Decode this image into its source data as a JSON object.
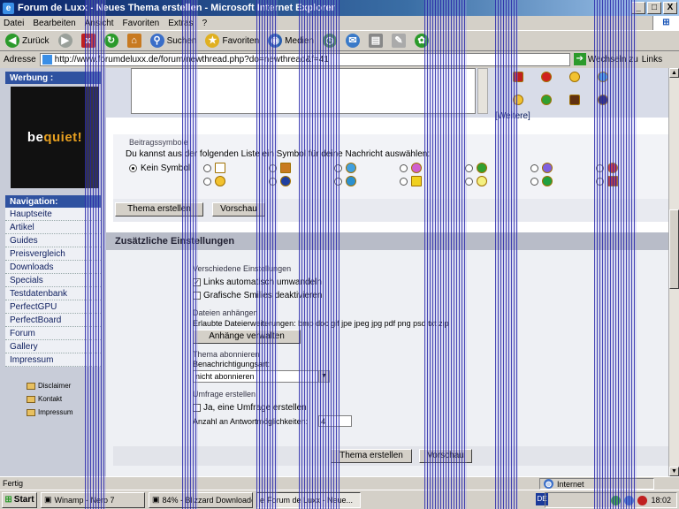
{
  "window": {
    "title": "Forum de Luxx - Neues Thema erstellen - Microsoft Internet Explorer",
    "controls": [
      "_",
      "□",
      "X"
    ]
  },
  "menu": [
    "Datei",
    "Bearbeiten",
    "Ansicht",
    "Favoriten",
    "Extras",
    "?"
  ],
  "toolbar": {
    "back": "Zurück",
    "search": "Suchen",
    "favorites": "Favoriten",
    "media": "Medien"
  },
  "address": {
    "label": "Adresse",
    "url": "http://www.forumdeluxx.de/forum/newthread.php?do=newthread&f=41",
    "go": "Wechseln zu",
    "links": "Links"
  },
  "sidebar": {
    "ad_heading": "Werbung :",
    "ad_text_1": "be ",
    "ad_text_2": "quiet!",
    "nav_heading": "Navigation:",
    "nav_items": [
      "Hauptseite",
      "Artikel",
      "Guides",
      "Preisvergleich",
      "Downloads",
      "Specials",
      "Testdatenbank",
      "PerfectGPU",
      "PerfectBoard",
      "Forum",
      "Gallery",
      "Impressum"
    ],
    "sub_items": [
      "Disclaimer",
      "Kontakt",
      "Impressum"
    ]
  },
  "editor": {
    "more_link": "[Weitere]"
  },
  "symbols": {
    "heading": "Beitragssymbole",
    "instruction": "Du kannst aus der folgenden Liste ein Symbol für deine Nachricht auswählen:",
    "none_label": "Kein Symbol"
  },
  "buttons": {
    "create_thread": "Thema erstellen",
    "preview": "Vorschau"
  },
  "extra_settings": {
    "heading": "Zusätzliche Einstellungen",
    "misc_heading": "Verschiedene Einstellungen",
    "auto_links": "Links automatisch umwandeln",
    "disable_smilies": "Grafische Smilies deaktivieren",
    "attach_heading": "Dateien anhängen",
    "allowed_ext": "Erlaubte Dateierweiterungen: bmp doc gif jpe jpeg jpg pdf png psd txt zip",
    "manage_attachments": "Anhänge verwalten",
    "subscribe_heading": "Thema abonnieren",
    "notify_label": "Benachrichtigungsart:",
    "notify_value": "nicht abonnieren",
    "poll_heading": "Umfrage erstellen",
    "poll_yes": "Ja, eine Umfrage erstellen",
    "poll_options_label": "Anzahl an Antwortmöglichkeiten:",
    "poll_options_value": "4"
  },
  "status": {
    "text": "Fertig",
    "zone": "Internet"
  },
  "taskbar": {
    "start": "Start",
    "tasks": [
      "Winamp - Nero 7",
      "84% - Blizzard Downloader",
      "Forum de Luxx - Neue..."
    ],
    "lang": "DE",
    "clock": "18:02"
  }
}
